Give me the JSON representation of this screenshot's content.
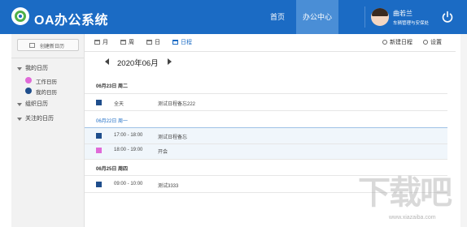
{
  "header": {
    "app_title": "OA办公系统",
    "nav": [
      "首页",
      "办公中心"
    ],
    "active_nav": "办公中心",
    "user_name": "曲若兰",
    "user_dept": "车辆管理与安保处",
    "colors": {
      "header_bg": "#1b6bc4",
      "active_nav_bg": "#4a8ed6"
    },
    "icons": {
      "logo": "oa-logo-icon",
      "power": "power-icon"
    }
  },
  "sidebar": {
    "new_calendar_label": "创建新日历",
    "groups": [
      {
        "label": "我的日历",
        "items": [
          {
            "label": "工作日历",
            "color": "#e06ad8",
            "checked": true
          },
          {
            "label": "我的日历",
            "color": "#1f4e8c",
            "checked": true
          }
        ]
      },
      {
        "label": "组织日历",
        "items": []
      },
      {
        "label": "关注的日历",
        "items": []
      }
    ]
  },
  "toolbar": {
    "views": [
      "月",
      "周",
      "日",
      "日程"
    ],
    "active_view": "日程",
    "new_schedule_label": "新建日程",
    "settings_label": "设置"
  },
  "calendar": {
    "current_month": "2020年06月",
    "days": [
      {
        "date_label": "06月23日 周二",
        "events": [
          {
            "time": "全天",
            "title": "测试日程备忘222",
            "color": "#1f4e8c"
          }
        ]
      },
      {
        "date_label": "06月22日 周一",
        "highlighted": true,
        "events": [
          {
            "time": "17:00 - 18:00",
            "title": "测试日程备忘",
            "color": "#1f4e8c"
          },
          {
            "time": "18:00 - 19:00",
            "title": "开会",
            "color": "#e06ad8"
          }
        ]
      },
      {
        "date_label": "06月25日 周四",
        "events": [
          {
            "time": "09:00 - 10:00",
            "title": "测试3333",
            "color": "#1f4e8c"
          }
        ]
      }
    ]
  },
  "watermark": {
    "text": "下载吧",
    "url": "www.xiazaiba.com"
  }
}
